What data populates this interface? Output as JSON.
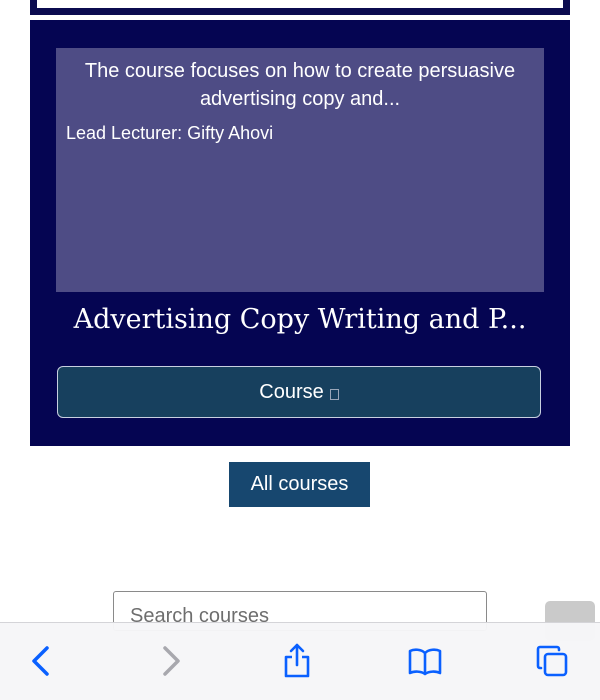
{
  "course": {
    "summary": "The course focuses on how to create persuasive advertising copy and...",
    "lecturer": "Lead Lecturer: Gifty Ahovi",
    "title": "Advertising Copy Writing and P...",
    "button_label": "Course"
  },
  "all_courses_label": "All courses",
  "search": {
    "placeholder": "Search courses"
  },
  "toolbar": {
    "icons": [
      "back-icon",
      "forward-icon",
      "share-icon",
      "bookmarks-icon",
      "tabs-icon"
    ]
  },
  "colors": {
    "card_background": "#050552",
    "summary_background": "#4e4c85",
    "button_background": "#17405e",
    "all_courses_background": "#17476f",
    "toolbar_accent": "#0a60ff"
  }
}
